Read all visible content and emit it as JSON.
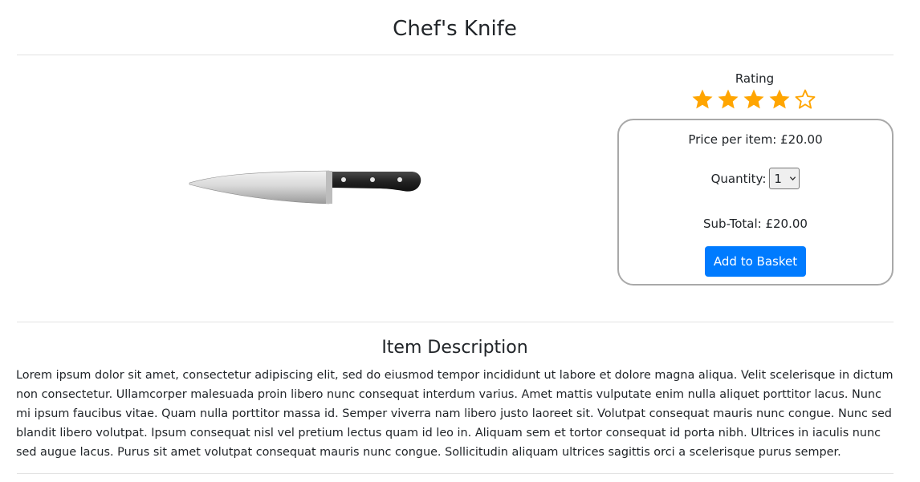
{
  "product": {
    "title": "Chef's Knife",
    "image_alt": "chef-knife"
  },
  "rating": {
    "label": "Rating",
    "value": 4,
    "max": 5,
    "star_color": "#FFA500"
  },
  "purchase": {
    "price_label": "Price per item: £20.00",
    "quantity_label": "Quantity:",
    "quantity_value": "1",
    "subtotal_label": "Sub-Total: £20.00",
    "add_button_label": "Add to Basket",
    "button_color": "#007bff"
  },
  "description": {
    "heading": "Item Description",
    "text": "Lorem ipsum dolor sit amet, consectetur adipiscing elit, sed do eiusmod tempor incididunt ut labore et dolore magna aliqua. Velit scelerisque in dictum non consectetur. Ullamcorper malesuada proin libero nunc consequat interdum varius. Amet mattis vulputate enim nulla aliquet porttitor lacus. Nunc mi ipsum faucibus vitae. Quam nulla porttitor massa id. Semper viverra nam libero justo laoreet sit. Volutpat consequat mauris nunc congue. Nunc sed blandit libero volutpat. Ipsum consequat nisl vel pretium lectus quam id leo in. Aliquam sem et tortor consequat id porta nibh. Ultrices in iaculis nunc sed augue lacus. Purus sit amet volutpat consequat mauris nunc congue. Sollicitudin aliquam ultrices sagittis orci a scelerisque purus semper."
  }
}
